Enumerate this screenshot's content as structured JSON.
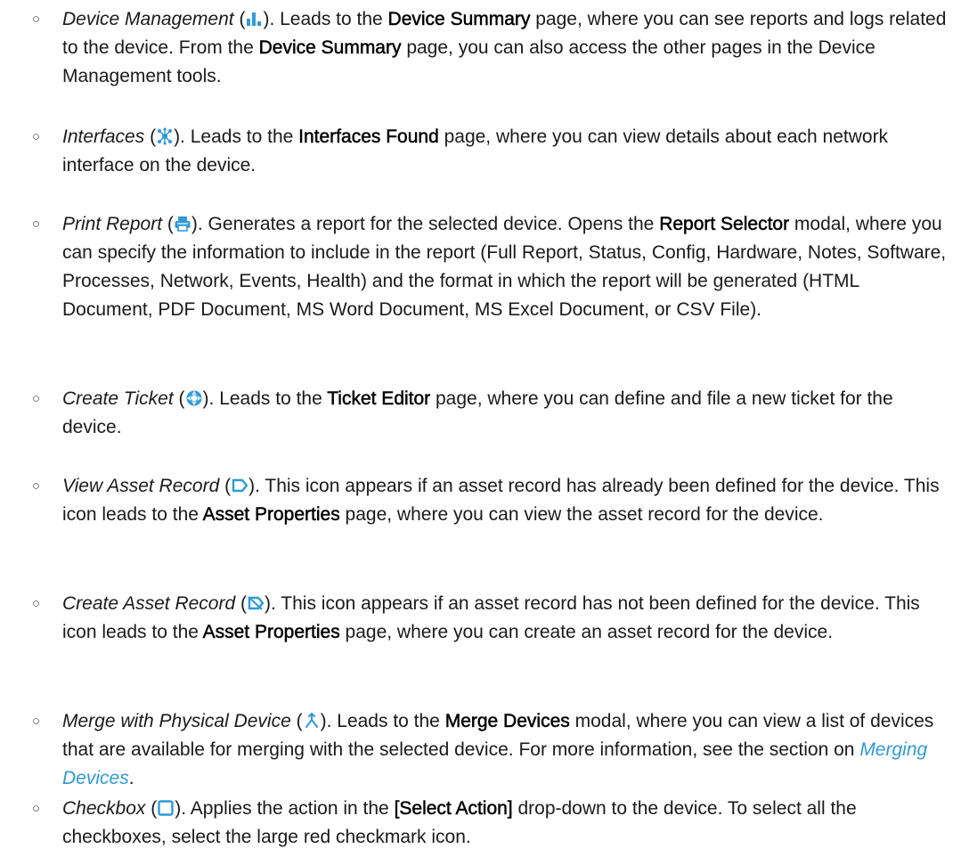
{
  "items": [
    {
      "name": "Device Management",
      "icon": "bar-chart-icon",
      "s1": "). Leads to the ",
      "b1": "Device Summary",
      "s2": " page, where you can see reports and logs related to the device. From the ",
      "b2": "Device Summary",
      "s3": " page, you can also access the other pages in the Device Management tools."
    },
    {
      "name": "Interfaces",
      "icon": "network-interfaces-icon",
      "s1": "). Leads to the ",
      "b1": "Interfaces Found",
      "s2": " page, where you can view details about each network interface on the device."
    },
    {
      "name": "Print Report",
      "icon": "printer-icon",
      "s1": "). Generates a report for the selected device. Opens the ",
      "b1": "Report Selector",
      "s2": " modal, where you can specify the information to include in the report (Full Report, Status, Config, Hardware, Notes, Software, Processes, Network, Events, Health) and the format in which the report will be generated (HTML Document, PDF Document, MS Word Document, MS Excel Document, or CSV File)."
    },
    {
      "name": "Create Ticket",
      "icon": "lifebuoy-icon",
      "s1": "). Leads to the ",
      "b1": "Ticket Editor",
      "s2": " page, where you can define and file a new ticket for the device."
    },
    {
      "name": "View Asset Record",
      "icon": "asset-record-icon",
      "s1": "). This icon appears if an asset record has already been defined for the device. This icon leads to the ",
      "b1": "Asset Properties",
      "s2": " page, where you can view the asset record for the device."
    },
    {
      "name": "Create Asset Record",
      "icon": "create-asset-record-icon",
      "s1": "). This icon appears if an asset record has not been defined for the device. This icon leads to the ",
      "b1": "Asset Properties",
      "s2": " page, where you can create an asset record for the device."
    },
    {
      "name": "Merge with Physical Device",
      "icon": "merge-icon",
      "s1": "). Leads to the ",
      "b1": "Merge Devices",
      "s2": " modal, where you can view a list of devices that are available for merging with the selected device. For more information, see the section on ",
      "link": "Merging Devices",
      "s3": "."
    },
    {
      "name": "Checkbox",
      "icon": "checkbox-icon",
      "s1": "). Applies the action in the ",
      "b1": "[Select Action]",
      "s2": " drop-down to the device. To select all the checkboxes, select the large red checkmark icon."
    }
  ],
  "colors": {
    "icon_blue": "#2e9ad8",
    "link": "#2e9ad8",
    "text": "#1a1a1a"
  }
}
